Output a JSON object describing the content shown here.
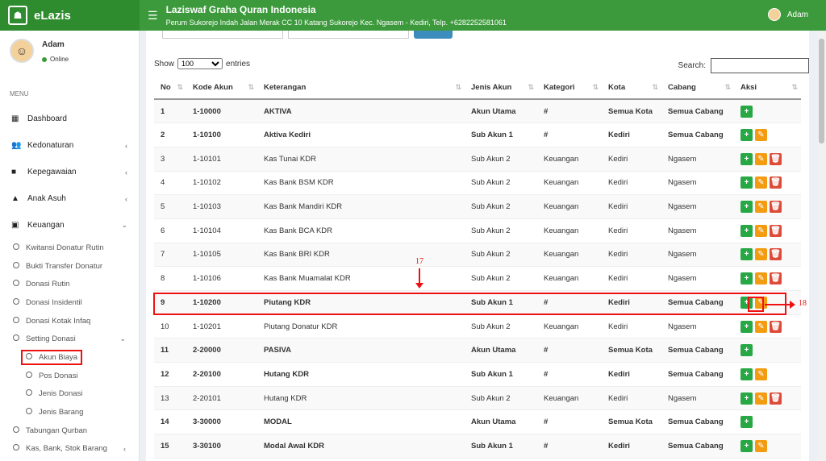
{
  "app": {
    "name": "eLazis",
    "org_title": "Laziswaf Graha Quran Indonesia",
    "org_address": "Perum Sukorejo Indah Jalan Merak CC 10 Katang Sukorejo Kec. Ngasem - Kediri, Telp. +6282252581061"
  },
  "user": {
    "name": "Adam",
    "status": "Online"
  },
  "sidebar": {
    "menu_label": "MENU",
    "items": [
      {
        "label": "Dashboard",
        "icon": "th-icon"
      },
      {
        "label": "Kedonaturan",
        "icon": "users-icon"
      },
      {
        "label": "Kepegawaian",
        "icon": "briefcase-icon"
      },
      {
        "label": "Anak Asuh",
        "icon": "graduation-cap-icon"
      },
      {
        "label": "Keuangan",
        "icon": "money-icon"
      }
    ],
    "keuangan_sub": [
      "Kwitansi Donatur Rutin",
      "Bukti Transfer Donatur",
      "Donasi Rutin",
      "Donasi Insidentil",
      "Donasi Kotak Infaq",
      "Setting Donasi"
    ],
    "setting_sub": [
      "Akun Biaya",
      "Pos Donasi",
      "Jenis Donasi",
      "Jenis Barang"
    ],
    "more_sub": [
      "Tabungan Qurban",
      "Kas, Bank, Stok Barang"
    ]
  },
  "table_controls": {
    "show_label": "Show",
    "show_value": "100",
    "entries_label": "entries",
    "search_label": "Search:"
  },
  "table": {
    "headers": [
      "No",
      "Kode Akun",
      "Keterangan",
      "Jenis Akun",
      "Kategori",
      "Kota",
      "Cabang",
      "Aksi"
    ],
    "rows": [
      [
        "1",
        "1-10000",
        "AKTIVA",
        "Akun Utama",
        "#",
        "Semua Kota",
        "Semua Cabang"
      ],
      [
        "2",
        "1-10100",
        "Aktiva Kediri",
        "Sub Akun 1",
        "#",
        "Kediri",
        "Semua Cabang"
      ],
      [
        "3",
        "1-10101",
        "Kas Tunai KDR",
        "Sub Akun 2",
        "Keuangan",
        "Kediri",
        "Ngasem"
      ],
      [
        "4",
        "1-10102",
        "Kas Bank BSM KDR",
        "Sub Akun 2",
        "Keuangan",
        "Kediri",
        "Ngasem"
      ],
      [
        "5",
        "1-10103",
        "Kas Bank Mandiri KDR",
        "Sub Akun 2",
        "Keuangan",
        "Kediri",
        "Ngasem"
      ],
      [
        "6",
        "1-10104",
        "Kas Bank BCA KDR",
        "Sub Akun 2",
        "Keuangan",
        "Kediri",
        "Ngasem"
      ],
      [
        "7",
        "1-10105",
        "Kas Bank BRI KDR",
        "Sub Akun 2",
        "Keuangan",
        "Kediri",
        "Ngasem"
      ],
      [
        "8",
        "1-10106",
        "Kas Bank Muamalat KDR",
        "Sub Akun 2",
        "Keuangan",
        "Kediri",
        "Ngasem"
      ],
      [
        "9",
        "1-10200",
        "Piutang KDR",
        "Sub Akun 1",
        "#",
        "Kediri",
        "Semua Cabang"
      ],
      [
        "10",
        "1-10201",
        "Piutang Donatur KDR",
        "Sub Akun 2",
        "Keuangan",
        "Kediri",
        "Ngasem"
      ],
      [
        "11",
        "2-20000",
        "PASIVA",
        "Akun Utama",
        "#",
        "Semua Kota",
        "Semua Cabang"
      ],
      [
        "12",
        "2-20100",
        "Hutang KDR",
        "Sub Akun 1",
        "#",
        "Kediri",
        "Semua Cabang"
      ],
      [
        "13",
        "2-20101",
        "Hutang KDR",
        "Sub Akun 2",
        "Keuangan",
        "Kediri",
        "Ngasem"
      ],
      [
        "14",
        "3-30000",
        "MODAL",
        "Akun Utama",
        "#",
        "Semua Kota",
        "Semua Cabang"
      ],
      [
        "15",
        "3-30100",
        "Modal Awal KDR",
        "Sub Akun 1",
        "#",
        "Kediri",
        "Semua Cabang"
      ]
    ]
  },
  "annotations": {
    "a17": "17",
    "a18": "18"
  },
  "colors": {
    "brand": "#3c9a3c",
    "add": "#28a745",
    "edit": "#f39c12",
    "delete": "#dd4b39",
    "highlight": "#e11111"
  }
}
